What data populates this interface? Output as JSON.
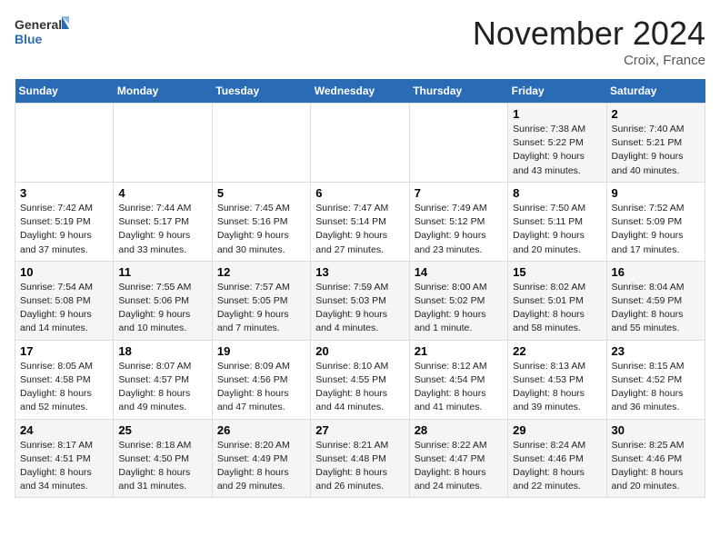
{
  "header": {
    "logo_general": "General",
    "logo_blue": "Blue",
    "month_title": "November 2024",
    "location": "Croix, France"
  },
  "days_of_week": [
    "Sunday",
    "Monday",
    "Tuesday",
    "Wednesday",
    "Thursday",
    "Friday",
    "Saturday"
  ],
  "weeks": [
    [
      {
        "day": "",
        "info": ""
      },
      {
        "day": "",
        "info": ""
      },
      {
        "day": "",
        "info": ""
      },
      {
        "day": "",
        "info": ""
      },
      {
        "day": "",
        "info": ""
      },
      {
        "day": "1",
        "info": "Sunrise: 7:38 AM\nSunset: 5:22 PM\nDaylight: 9 hours and 43 minutes."
      },
      {
        "day": "2",
        "info": "Sunrise: 7:40 AM\nSunset: 5:21 PM\nDaylight: 9 hours and 40 minutes."
      }
    ],
    [
      {
        "day": "3",
        "info": "Sunrise: 7:42 AM\nSunset: 5:19 PM\nDaylight: 9 hours and 37 minutes."
      },
      {
        "day": "4",
        "info": "Sunrise: 7:44 AM\nSunset: 5:17 PM\nDaylight: 9 hours and 33 minutes."
      },
      {
        "day": "5",
        "info": "Sunrise: 7:45 AM\nSunset: 5:16 PM\nDaylight: 9 hours and 30 minutes."
      },
      {
        "day": "6",
        "info": "Sunrise: 7:47 AM\nSunset: 5:14 PM\nDaylight: 9 hours and 27 minutes."
      },
      {
        "day": "7",
        "info": "Sunrise: 7:49 AM\nSunset: 5:12 PM\nDaylight: 9 hours and 23 minutes."
      },
      {
        "day": "8",
        "info": "Sunrise: 7:50 AM\nSunset: 5:11 PM\nDaylight: 9 hours and 20 minutes."
      },
      {
        "day": "9",
        "info": "Sunrise: 7:52 AM\nSunset: 5:09 PM\nDaylight: 9 hours and 17 minutes."
      }
    ],
    [
      {
        "day": "10",
        "info": "Sunrise: 7:54 AM\nSunset: 5:08 PM\nDaylight: 9 hours and 14 minutes."
      },
      {
        "day": "11",
        "info": "Sunrise: 7:55 AM\nSunset: 5:06 PM\nDaylight: 9 hours and 10 minutes."
      },
      {
        "day": "12",
        "info": "Sunrise: 7:57 AM\nSunset: 5:05 PM\nDaylight: 9 hours and 7 minutes."
      },
      {
        "day": "13",
        "info": "Sunrise: 7:59 AM\nSunset: 5:03 PM\nDaylight: 9 hours and 4 minutes."
      },
      {
        "day": "14",
        "info": "Sunrise: 8:00 AM\nSunset: 5:02 PM\nDaylight: 9 hours and 1 minute."
      },
      {
        "day": "15",
        "info": "Sunrise: 8:02 AM\nSunset: 5:01 PM\nDaylight: 8 hours and 58 minutes."
      },
      {
        "day": "16",
        "info": "Sunrise: 8:04 AM\nSunset: 4:59 PM\nDaylight: 8 hours and 55 minutes."
      }
    ],
    [
      {
        "day": "17",
        "info": "Sunrise: 8:05 AM\nSunset: 4:58 PM\nDaylight: 8 hours and 52 minutes."
      },
      {
        "day": "18",
        "info": "Sunrise: 8:07 AM\nSunset: 4:57 PM\nDaylight: 8 hours and 49 minutes."
      },
      {
        "day": "19",
        "info": "Sunrise: 8:09 AM\nSunset: 4:56 PM\nDaylight: 8 hours and 47 minutes."
      },
      {
        "day": "20",
        "info": "Sunrise: 8:10 AM\nSunset: 4:55 PM\nDaylight: 8 hours and 44 minutes."
      },
      {
        "day": "21",
        "info": "Sunrise: 8:12 AM\nSunset: 4:54 PM\nDaylight: 8 hours and 41 minutes."
      },
      {
        "day": "22",
        "info": "Sunrise: 8:13 AM\nSunset: 4:53 PM\nDaylight: 8 hours and 39 minutes."
      },
      {
        "day": "23",
        "info": "Sunrise: 8:15 AM\nSunset: 4:52 PM\nDaylight: 8 hours and 36 minutes."
      }
    ],
    [
      {
        "day": "24",
        "info": "Sunrise: 8:17 AM\nSunset: 4:51 PM\nDaylight: 8 hours and 34 minutes."
      },
      {
        "day": "25",
        "info": "Sunrise: 8:18 AM\nSunset: 4:50 PM\nDaylight: 8 hours and 31 minutes."
      },
      {
        "day": "26",
        "info": "Sunrise: 8:20 AM\nSunset: 4:49 PM\nDaylight: 8 hours and 29 minutes."
      },
      {
        "day": "27",
        "info": "Sunrise: 8:21 AM\nSunset: 4:48 PM\nDaylight: 8 hours and 26 minutes."
      },
      {
        "day": "28",
        "info": "Sunrise: 8:22 AM\nSunset: 4:47 PM\nDaylight: 8 hours and 24 minutes."
      },
      {
        "day": "29",
        "info": "Sunrise: 8:24 AM\nSunset: 4:46 PM\nDaylight: 8 hours and 22 minutes."
      },
      {
        "day": "30",
        "info": "Sunrise: 8:25 AM\nSunset: 4:46 PM\nDaylight: 8 hours and 20 minutes."
      }
    ]
  ]
}
